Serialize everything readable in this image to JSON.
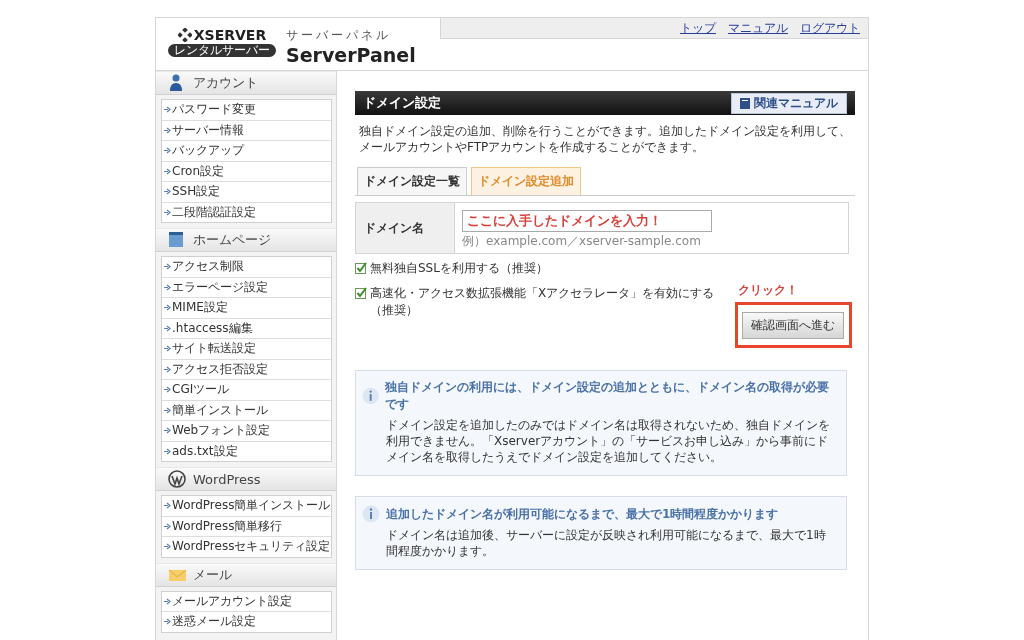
{
  "header": {
    "logo": {
      "brand": "XSERVER",
      "badge": "レンタルサーバー",
      "subtitle": "サーバーパネル",
      "product": "ServerPanel"
    },
    "nav_links": [
      "トップ",
      "マニュアル",
      "ログアウト"
    ]
  },
  "sidebar": {
    "sections": [
      {
        "kind": "account",
        "title": "アカウント",
        "items": [
          "パスワード変更",
          "サーバー情報",
          "バックアップ",
          "Cron設定",
          "SSH設定",
          "二段階認証設定"
        ]
      },
      {
        "kind": "homepage",
        "title": "ホームページ",
        "items": [
          "アクセス制限",
          "エラーページ設定",
          "MIME設定",
          ".htaccess編集",
          "サイト転送設定",
          "アクセス拒否設定",
          "CGIツール",
          "簡単インストール",
          "Webフォント設定",
          "ads.txt設定"
        ]
      },
      {
        "kind": "wordpress",
        "title": "WordPress",
        "items": [
          "WordPress簡単インストール",
          "WordPress簡単移行",
          "WordPressセキュリティ設定"
        ]
      },
      {
        "kind": "mail",
        "title": "メール",
        "items": [
          "メールアカウント設定",
          "迷惑メール設定"
        ]
      }
    ]
  },
  "main": {
    "title": "ドメイン設定",
    "manual_button": "関連マニュアル",
    "description": "独自ドメイン設定の追加、削除を行うことができます。追加したドメイン設定を利用して、メールアカウントやFTPアカウントを作成することができます。",
    "tabs": [
      {
        "label": "ドメイン設定一覧",
        "selected": false
      },
      {
        "label": "ドメイン設定追加",
        "selected": true
      }
    ],
    "form": {
      "label": "ドメイン名",
      "value": "ここに入手したドメインを入力！",
      "hint": "例）example.com／xserver-sample.com"
    },
    "options": [
      {
        "label": "無料独自SSLを利用する（推奨）",
        "checked": true
      },
      {
        "label": "高速化・アクセス数拡張機能「Xアクセラレータ」を有効にする（推奨）",
        "checked": true
      }
    ],
    "annotation": "クリック！",
    "submit_button": "確認画面へ進む",
    "notices": [
      {
        "title": "独自ドメインの利用には、ドメイン設定の追加とともに、ドメイン名の取得が必要です",
        "body": "ドメイン設定を追加したのみではドメイン名は取得されないため、独自ドメインを利用できません。「Xserverアカウント」の「サービスお申し込み」から事前にドメイン名を取得したうえでドメイン設定を追加してください。"
      },
      {
        "title": "追加したドメイン名が利用可能になるまで、最大で1時間程度かかります",
        "body": "ドメイン名は追加後、サーバーに設定が反映され利用可能になるまで、最大で1時間程度かかります。"
      }
    ]
  }
}
